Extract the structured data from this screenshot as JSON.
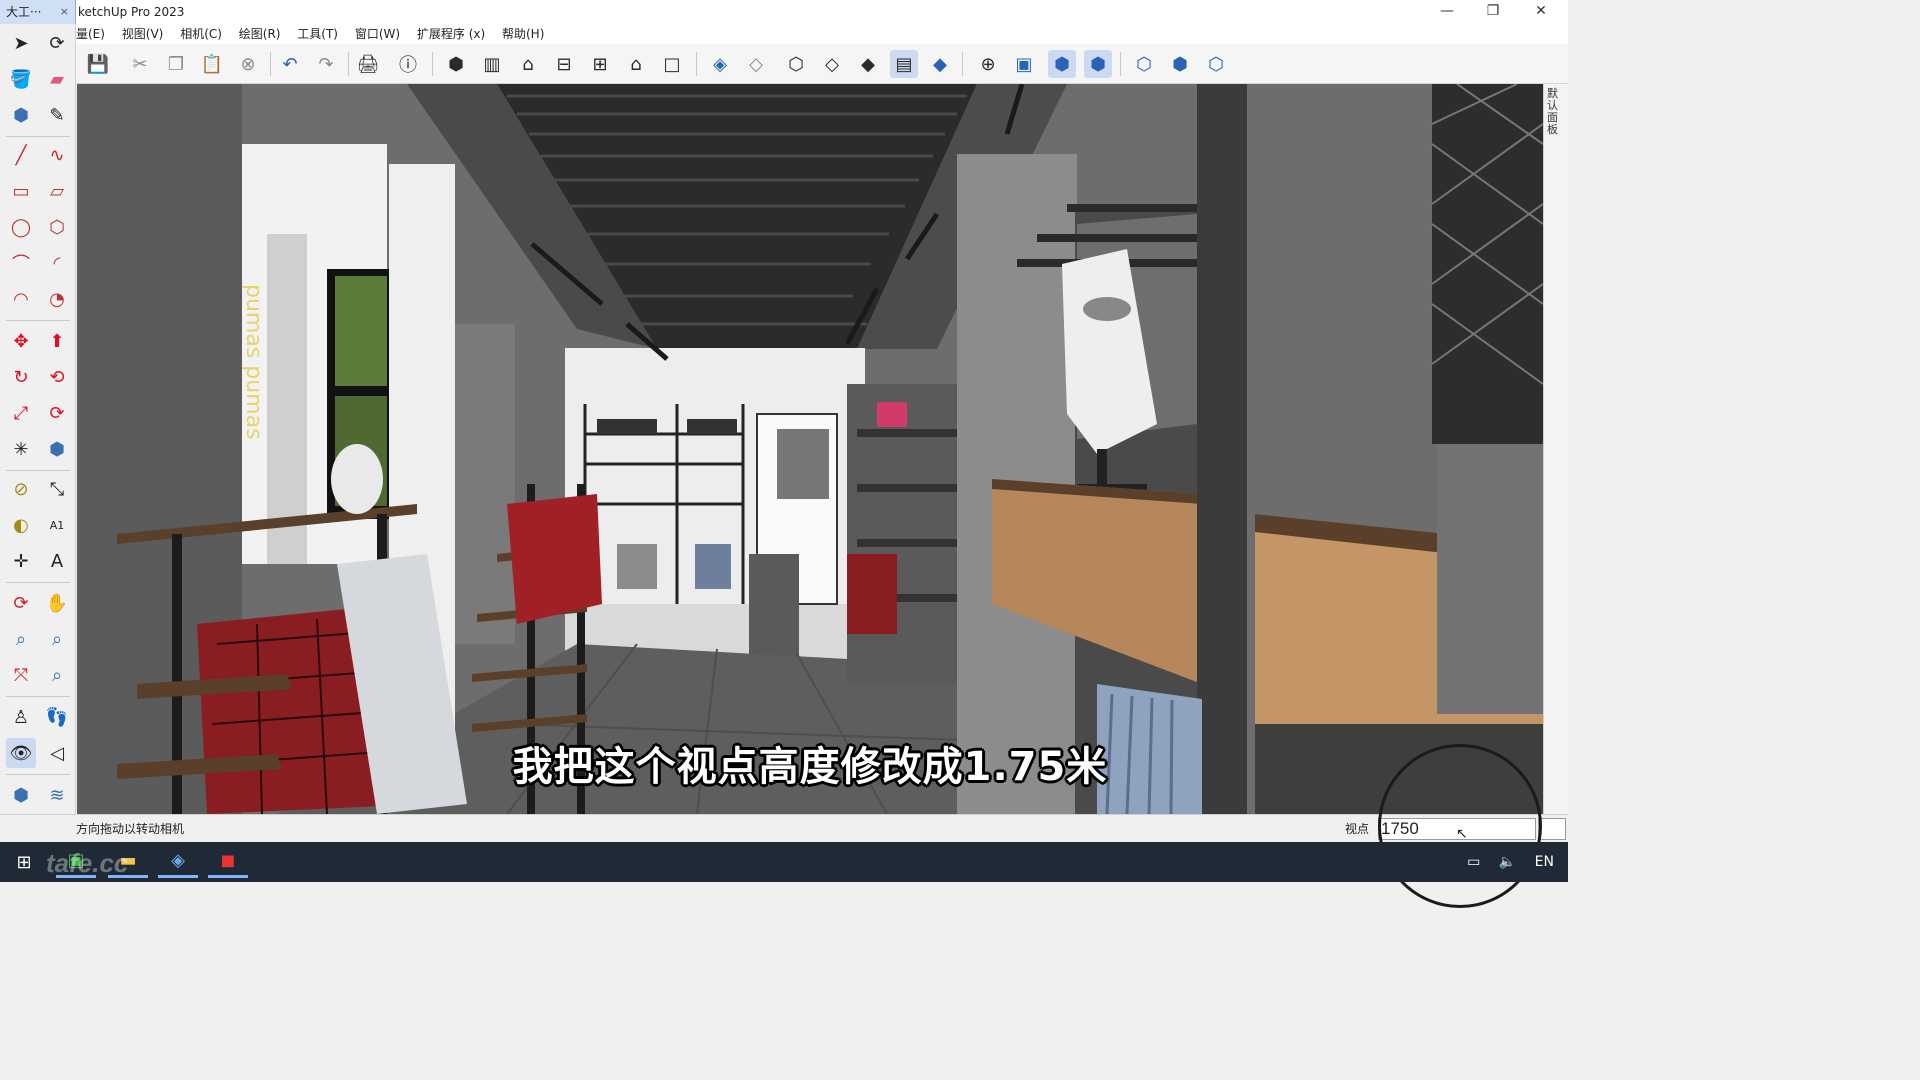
{
  "window": {
    "doc_tab": "大工···",
    "doc_tab_close": "×",
    "title": "ketchUp Pro 2023",
    "controls": {
      "minimize": "—",
      "maximize": "❐",
      "close": "✕"
    }
  },
  "menu": [
    "量(E)",
    "视图(V)",
    "相机(C)",
    "绘图(R)",
    "工具(T)",
    "窗口(W)",
    "扩展程序 (x)",
    "帮助(H)"
  ],
  "toolbar_icons": [
    "save-icon",
    "cut-icon",
    "copy-icon",
    "paste-icon",
    "erase-icon",
    "undo-icon",
    "redo-icon",
    "print-icon",
    "model-info-icon",
    "iso-view-icon",
    "top-view-icon",
    "front-view-icon",
    "right-view-icon",
    "back-view-icon",
    "left-view-icon",
    "bottom-view-icon",
    "xray-icon",
    "back-edges-icon",
    "wireframe-icon",
    "hidden-line-icon",
    "shaded-icon",
    "shaded-textures-icon",
    "monochrome-icon",
    "section-plane-icon",
    "display-section-planes-icon",
    "display-section-cuts-icon",
    "display-section-fill-icon",
    "outliner-icon",
    "components-icon",
    "materials-icon"
  ],
  "left_tools": [
    "select-icon",
    "orbit-small-icon",
    "paint-bucket-icon",
    "eraser-icon",
    "component-icon",
    "tape-icon",
    "line-icon",
    "freehand-icon",
    "rectangle-icon",
    "rotated-rectangle-icon",
    "circle-icon",
    "polygon-icon",
    "arc-icon",
    "two-point-arc-icon",
    "three-point-arc-icon",
    "pie-icon",
    "move-icon",
    "push-pull-icon",
    "rotate-icon",
    "follow-me-icon",
    "scale-icon",
    "offset-icon",
    "axes-icon",
    "solid-tools-icon",
    "tape-measure-icon",
    "dimension-icon",
    "protractor-icon",
    "text-icon",
    "axes-tool-icon",
    "3d-text-icon",
    "orbit-icon",
    "pan-icon",
    "zoom-icon",
    "zoom-window-icon",
    "zoom-extents-icon",
    "previous-view-icon",
    "position-camera-icon",
    "walk-icon",
    "look-around-icon",
    "section-icon",
    "sandbox-icon",
    "sandbox-smoove-icon",
    "layers-icon",
    "stamp-icon"
  ],
  "tray": {
    "label": "默认面板"
  },
  "viewport": {
    "subtitle": "我把这个视点高度修改成1.75米",
    "store_sign": "pumas pumas"
  },
  "statusbar": {
    "hint": "方向拖动以转动相机",
    "vcb_label": "视点",
    "vcb_value": "1750"
  },
  "taskbar": {
    "watermark": "tafe.cc",
    "lang": "EN",
    "icons": [
      "start-icon",
      "app-icon",
      "file-explorer-icon",
      "sketchup-icon",
      "camtasia-icon"
    ]
  }
}
